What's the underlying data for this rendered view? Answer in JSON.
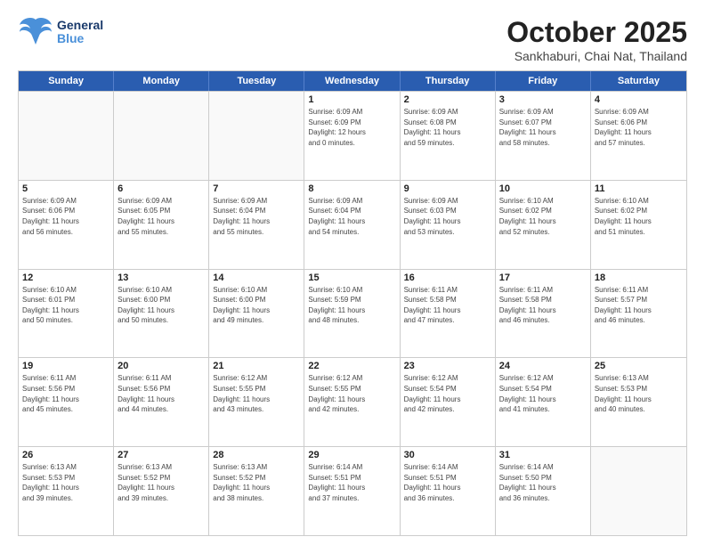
{
  "header": {
    "logo_general": "General",
    "logo_blue": "Blue",
    "month_title": "October 2025",
    "location": "Sankhaburi, Chai Nat, Thailand"
  },
  "weekdays": [
    "Sunday",
    "Monday",
    "Tuesday",
    "Wednesday",
    "Thursday",
    "Friday",
    "Saturday"
  ],
  "rows": [
    [
      {
        "day": "",
        "lines": []
      },
      {
        "day": "",
        "lines": []
      },
      {
        "day": "",
        "lines": []
      },
      {
        "day": "1",
        "lines": [
          "Sunrise: 6:09 AM",
          "Sunset: 6:09 PM",
          "Daylight: 12 hours",
          "and 0 minutes."
        ]
      },
      {
        "day": "2",
        "lines": [
          "Sunrise: 6:09 AM",
          "Sunset: 6:08 PM",
          "Daylight: 11 hours",
          "and 59 minutes."
        ]
      },
      {
        "day": "3",
        "lines": [
          "Sunrise: 6:09 AM",
          "Sunset: 6:07 PM",
          "Daylight: 11 hours",
          "and 58 minutes."
        ]
      },
      {
        "day": "4",
        "lines": [
          "Sunrise: 6:09 AM",
          "Sunset: 6:06 PM",
          "Daylight: 11 hours",
          "and 57 minutes."
        ]
      }
    ],
    [
      {
        "day": "5",
        "lines": [
          "Sunrise: 6:09 AM",
          "Sunset: 6:06 PM",
          "Daylight: 11 hours",
          "and 56 minutes."
        ]
      },
      {
        "day": "6",
        "lines": [
          "Sunrise: 6:09 AM",
          "Sunset: 6:05 PM",
          "Daylight: 11 hours",
          "and 55 minutes."
        ]
      },
      {
        "day": "7",
        "lines": [
          "Sunrise: 6:09 AM",
          "Sunset: 6:04 PM",
          "Daylight: 11 hours",
          "and 55 minutes."
        ]
      },
      {
        "day": "8",
        "lines": [
          "Sunrise: 6:09 AM",
          "Sunset: 6:04 PM",
          "Daylight: 11 hours",
          "and 54 minutes."
        ]
      },
      {
        "day": "9",
        "lines": [
          "Sunrise: 6:09 AM",
          "Sunset: 6:03 PM",
          "Daylight: 11 hours",
          "and 53 minutes."
        ]
      },
      {
        "day": "10",
        "lines": [
          "Sunrise: 6:10 AM",
          "Sunset: 6:02 PM",
          "Daylight: 11 hours",
          "and 52 minutes."
        ]
      },
      {
        "day": "11",
        "lines": [
          "Sunrise: 6:10 AM",
          "Sunset: 6:02 PM",
          "Daylight: 11 hours",
          "and 51 minutes."
        ]
      }
    ],
    [
      {
        "day": "12",
        "lines": [
          "Sunrise: 6:10 AM",
          "Sunset: 6:01 PM",
          "Daylight: 11 hours",
          "and 50 minutes."
        ]
      },
      {
        "day": "13",
        "lines": [
          "Sunrise: 6:10 AM",
          "Sunset: 6:00 PM",
          "Daylight: 11 hours",
          "and 50 minutes."
        ]
      },
      {
        "day": "14",
        "lines": [
          "Sunrise: 6:10 AM",
          "Sunset: 6:00 PM",
          "Daylight: 11 hours",
          "and 49 minutes."
        ]
      },
      {
        "day": "15",
        "lines": [
          "Sunrise: 6:10 AM",
          "Sunset: 5:59 PM",
          "Daylight: 11 hours",
          "and 48 minutes."
        ]
      },
      {
        "day": "16",
        "lines": [
          "Sunrise: 6:11 AM",
          "Sunset: 5:58 PM",
          "Daylight: 11 hours",
          "and 47 minutes."
        ]
      },
      {
        "day": "17",
        "lines": [
          "Sunrise: 6:11 AM",
          "Sunset: 5:58 PM",
          "Daylight: 11 hours",
          "and 46 minutes."
        ]
      },
      {
        "day": "18",
        "lines": [
          "Sunrise: 6:11 AM",
          "Sunset: 5:57 PM",
          "Daylight: 11 hours",
          "and 46 minutes."
        ]
      }
    ],
    [
      {
        "day": "19",
        "lines": [
          "Sunrise: 6:11 AM",
          "Sunset: 5:56 PM",
          "Daylight: 11 hours",
          "and 45 minutes."
        ]
      },
      {
        "day": "20",
        "lines": [
          "Sunrise: 6:11 AM",
          "Sunset: 5:56 PM",
          "Daylight: 11 hours",
          "and 44 minutes."
        ]
      },
      {
        "day": "21",
        "lines": [
          "Sunrise: 6:12 AM",
          "Sunset: 5:55 PM",
          "Daylight: 11 hours",
          "and 43 minutes."
        ]
      },
      {
        "day": "22",
        "lines": [
          "Sunrise: 6:12 AM",
          "Sunset: 5:55 PM",
          "Daylight: 11 hours",
          "and 42 minutes."
        ]
      },
      {
        "day": "23",
        "lines": [
          "Sunrise: 6:12 AM",
          "Sunset: 5:54 PM",
          "Daylight: 11 hours",
          "and 42 minutes."
        ]
      },
      {
        "day": "24",
        "lines": [
          "Sunrise: 6:12 AM",
          "Sunset: 5:54 PM",
          "Daylight: 11 hours",
          "and 41 minutes."
        ]
      },
      {
        "day": "25",
        "lines": [
          "Sunrise: 6:13 AM",
          "Sunset: 5:53 PM",
          "Daylight: 11 hours",
          "and 40 minutes."
        ]
      }
    ],
    [
      {
        "day": "26",
        "lines": [
          "Sunrise: 6:13 AM",
          "Sunset: 5:53 PM",
          "Daylight: 11 hours",
          "and 39 minutes."
        ]
      },
      {
        "day": "27",
        "lines": [
          "Sunrise: 6:13 AM",
          "Sunset: 5:52 PM",
          "Daylight: 11 hours",
          "and 39 minutes."
        ]
      },
      {
        "day": "28",
        "lines": [
          "Sunrise: 6:13 AM",
          "Sunset: 5:52 PM",
          "Daylight: 11 hours",
          "and 38 minutes."
        ]
      },
      {
        "day": "29",
        "lines": [
          "Sunrise: 6:14 AM",
          "Sunset: 5:51 PM",
          "Daylight: 11 hours",
          "and 37 minutes."
        ]
      },
      {
        "day": "30",
        "lines": [
          "Sunrise: 6:14 AM",
          "Sunset: 5:51 PM",
          "Daylight: 11 hours",
          "and 36 minutes."
        ]
      },
      {
        "day": "31",
        "lines": [
          "Sunrise: 6:14 AM",
          "Sunset: 5:50 PM",
          "Daylight: 11 hours",
          "and 36 minutes."
        ]
      },
      {
        "day": "",
        "lines": []
      }
    ]
  ]
}
